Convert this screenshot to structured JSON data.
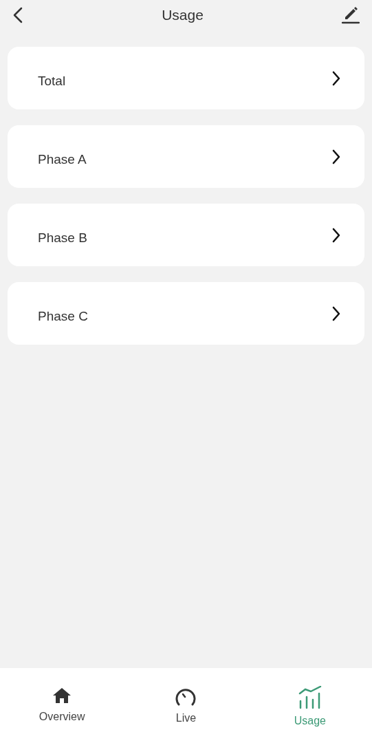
{
  "header": {
    "title": "Usage"
  },
  "items": [
    {
      "label": "Total"
    },
    {
      "label": "Phase A"
    },
    {
      "label": "Phase B"
    },
    {
      "label": "Phase C"
    }
  ],
  "tabs": [
    {
      "label": "Overview",
      "kind": "home",
      "selected": false
    },
    {
      "label": "Live",
      "kind": "gauge",
      "selected": false
    },
    {
      "label": "Usage",
      "kind": "chart",
      "selected": true
    }
  ]
}
